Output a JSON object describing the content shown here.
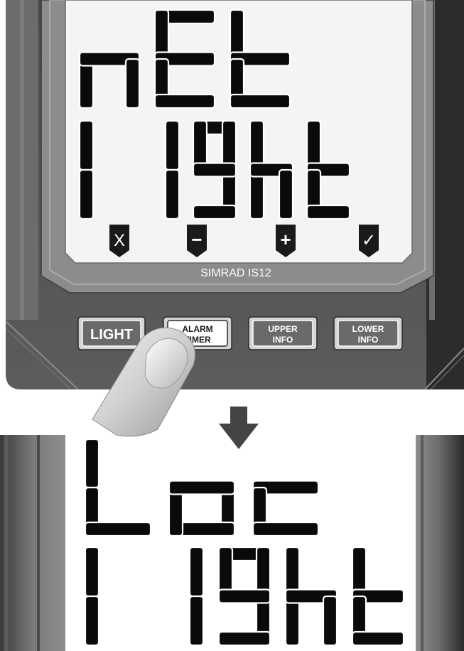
{
  "brand_label": "SIMRAD IS12",
  "display_top": {
    "line1": "nEt",
    "line2": "l1ght"
  },
  "display_bottom": {
    "line1": "Loc",
    "line2": "l1ght"
  },
  "softkeys": [
    {
      "name": "cancel-softkey",
      "glyph": "X"
    },
    {
      "name": "minus-softkey",
      "glyph": "−"
    },
    {
      "name": "plus-softkey",
      "glyph": "+"
    },
    {
      "name": "confirm-softkey",
      "glyph": "✓"
    }
  ],
  "buttons": {
    "light": "LIGHT",
    "alarm_timer": [
      "ALARM",
      "TIMER"
    ],
    "upper_info": [
      "UPPER",
      "INFO"
    ],
    "lower_info": [
      "LOWER",
      "INFO"
    ]
  },
  "icons": [
    "finger-press-icon",
    "down-arrow-icon"
  ],
  "colors": {
    "case_dark": "#5a5a5a",
    "bezel": "#8a8a8a",
    "lcd_background": "#f4f4f4",
    "segment": "#0a0a0a",
    "button_face": "#6a6a6a"
  }
}
